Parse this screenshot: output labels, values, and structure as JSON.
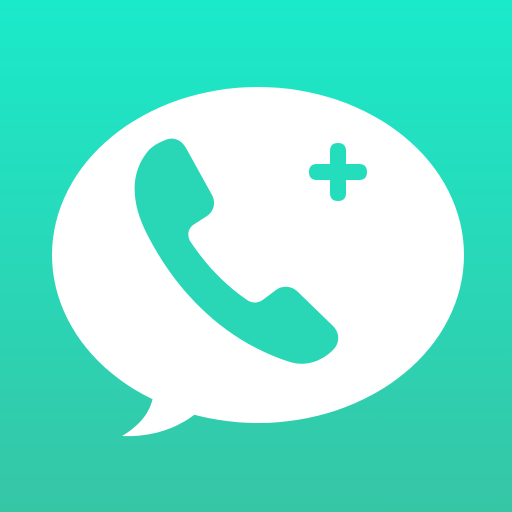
{
  "icon": {
    "name": "phone-call-add-app-icon",
    "background_gradient": {
      "top": "#1AEACA",
      "bottom": "#36C6A6"
    },
    "bubble_color": "#FFFFFF",
    "phone_color": "#29D6B6",
    "plus_color": "#24DDBD",
    "glyphs": [
      "speech-bubble-icon",
      "phone-handset-icon",
      "plus-icon"
    ]
  }
}
